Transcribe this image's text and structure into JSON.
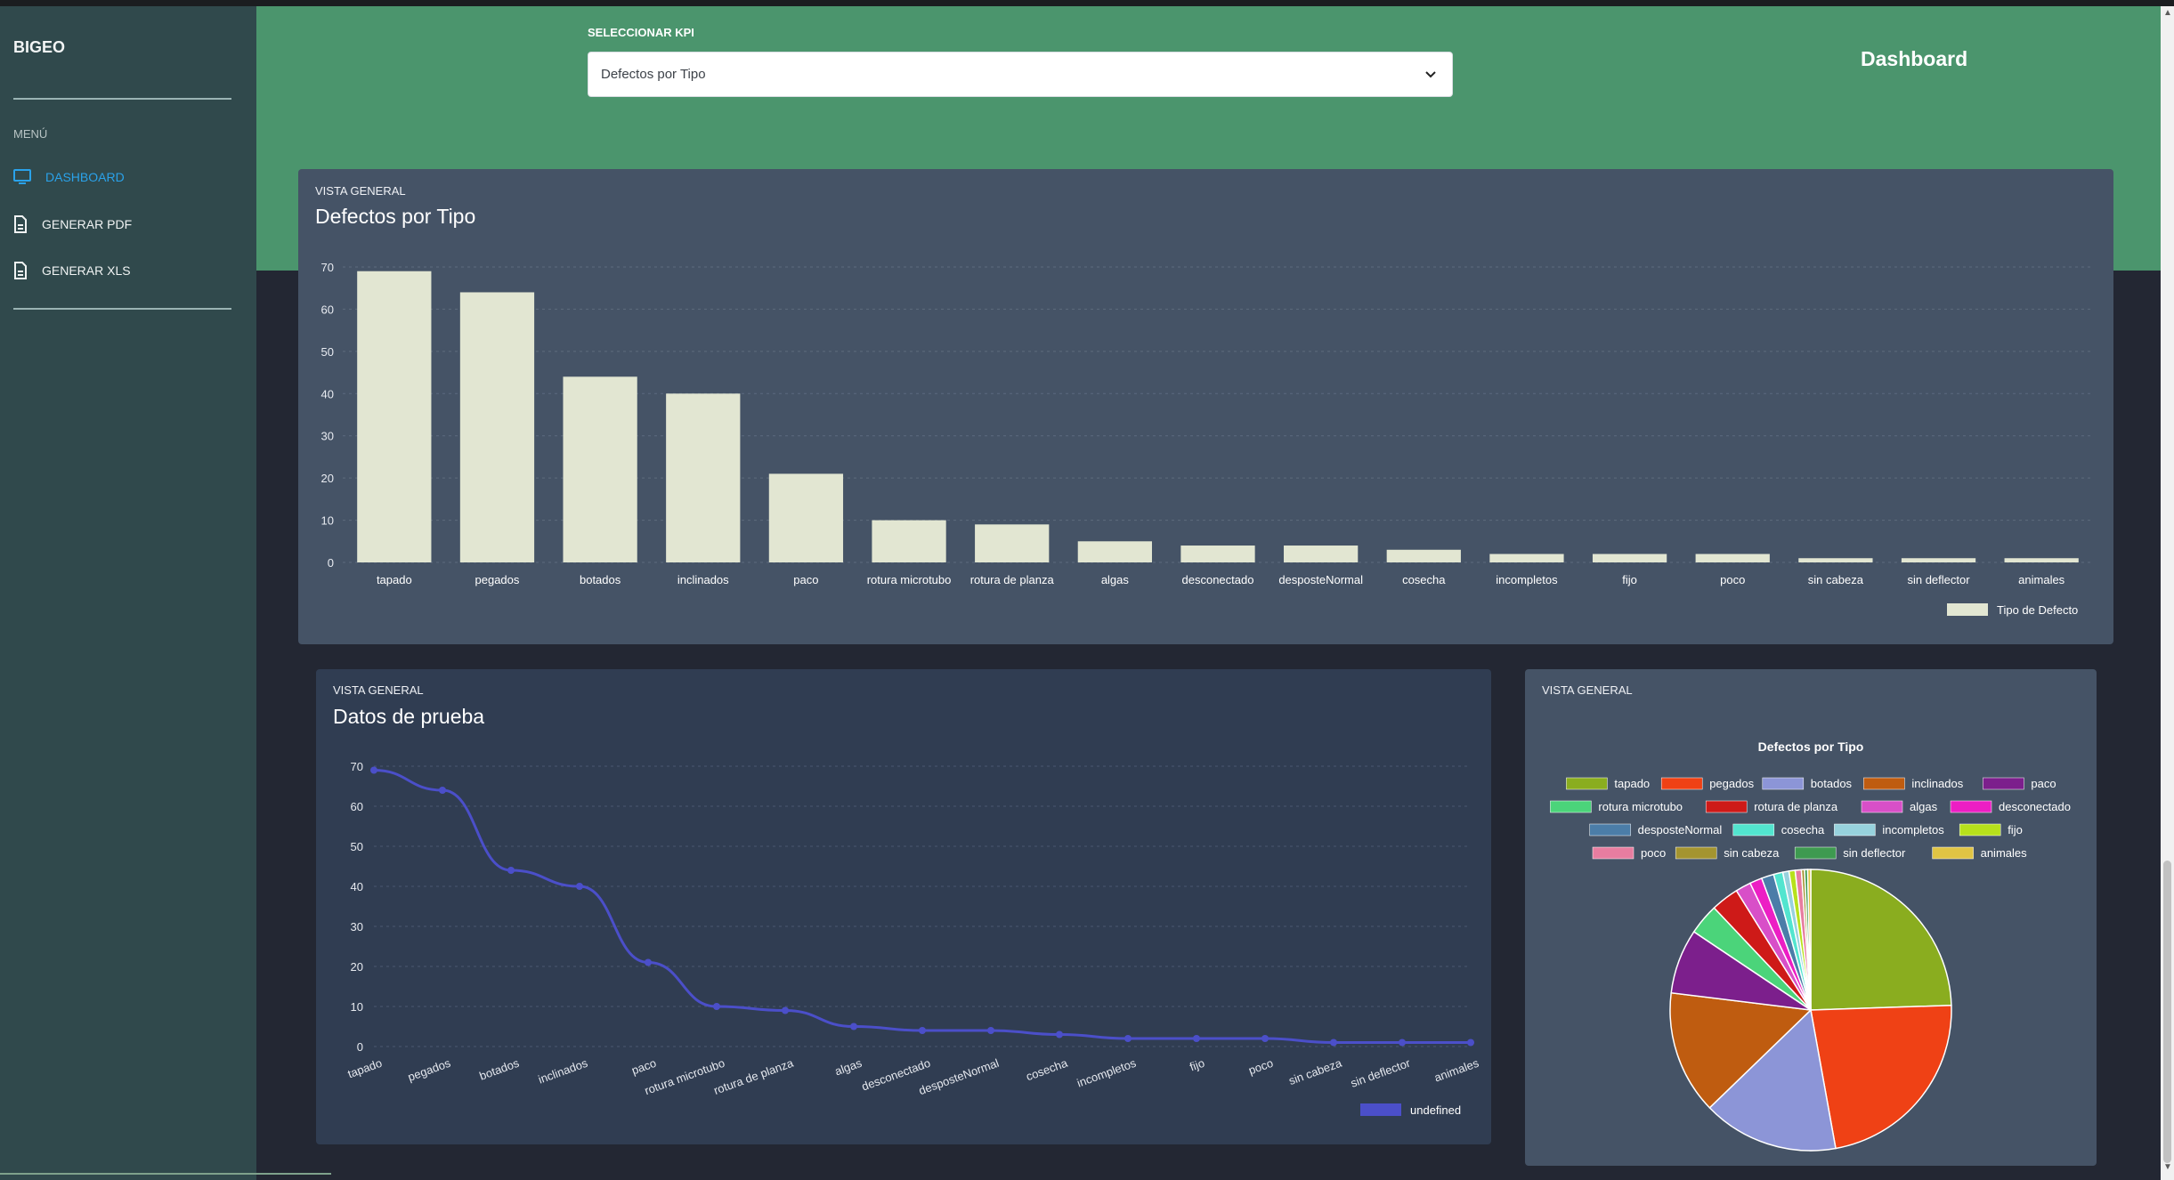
{
  "brand": "BIGEO",
  "sidebar": {
    "menu_title": "MENÚ",
    "items": [
      {
        "label": "DASHBOARD",
        "icon": "monitor-icon",
        "active": true
      },
      {
        "label": "GENERAR PDF",
        "icon": "file-icon",
        "active": false
      },
      {
        "label": "GENERAR XLS",
        "icon": "file-icon",
        "active": false
      }
    ]
  },
  "header": {
    "kpi_label": "SELECCIONAR KPI",
    "kpi_selected": "Defectos por Tipo",
    "title": "Dashboard"
  },
  "colors": {
    "sidebar": "#30494c",
    "header": "#4b956d",
    "active": "#2aa2ea",
    "bar": "#e2e6d2",
    "line": "#4b4fc9"
  },
  "cards": [
    {
      "eyebrow": "VISTA GENERAL",
      "title": "Defectos por Tipo"
    },
    {
      "eyebrow": "VISTA GENERAL",
      "title": "Datos de prueba"
    },
    {
      "eyebrow": "VISTA GENERAL",
      "title": ""
    }
  ],
  "chart_data": [
    {
      "type": "bar",
      "categories": [
        "tapado",
        "pegados",
        "botados",
        "inclinados",
        "paco",
        "rotura microtubo",
        "rotura de planza",
        "algas",
        "desconectado",
        "desposteNormal",
        "cosecha",
        "incompletos",
        "fijo",
        "poco",
        "sin cabeza",
        "sin deflector",
        "animales"
      ],
      "series": [
        {
          "name": "Tipo de Defecto",
          "values": [
            69,
            64,
            44,
            40,
            21,
            10,
            9,
            5,
            4,
            4,
            3,
            2,
            2,
            2,
            1,
            1,
            1
          ]
        }
      ],
      "ylim": [
        0,
        70
      ],
      "yticks": [
        0,
        10,
        20,
        30,
        40,
        50,
        60,
        70
      ],
      "grid": true,
      "legend": "bottom-right"
    },
    {
      "type": "line",
      "categories": [
        "tapado",
        "pegados",
        "botados",
        "inclinados",
        "paco",
        "rotura microtubo",
        "rotura de planza",
        "algas",
        "desconectado",
        "desposteNormal",
        "cosecha",
        "incompletos",
        "fijo",
        "poco",
        "sin cabeza",
        "sin deflector",
        "animales"
      ],
      "series": [
        {
          "name": "undefined",
          "values": [
            69,
            64,
            44,
            40,
            21,
            10,
            9,
            5,
            4,
            4,
            3,
            2,
            2,
            2,
            1,
            1,
            1
          ]
        }
      ],
      "ylim": [
        0,
        70
      ],
      "yticks": [
        0,
        10,
        20,
        30,
        40,
        50,
        60,
        70
      ],
      "grid": true,
      "legend": "bottom-right"
    },
    {
      "type": "pie",
      "title": "Defectos por Tipo",
      "labels": [
        "tapado",
        "pegados",
        "botados",
        "inclinados",
        "paco",
        "rotura microtubo",
        "rotura de planza",
        "algas",
        "desconectado",
        "desposteNormal",
        "cosecha",
        "incompletos",
        "fijo",
        "poco",
        "sin cabeza",
        "sin deflector",
        "animales"
      ],
      "values": [
        69,
        64,
        44,
        40,
        21,
        10,
        9,
        5,
        4,
        4,
        3,
        2,
        2,
        2,
        1,
        1,
        1
      ],
      "colors": [
        "#8aad1f",
        "#ef4115",
        "#8c95d7",
        "#bf5c10",
        "#7c1f8c",
        "#4bd47a",
        "#ce1a18",
        "#d84fc8",
        "#ec1ec4",
        "#4b7da8",
        "#52e5cf",
        "#97d2dd",
        "#b7e11b",
        "#e77da0",
        "#a49430",
        "#3e9a50",
        "#e0c444"
      ],
      "legend": "top"
    }
  ]
}
